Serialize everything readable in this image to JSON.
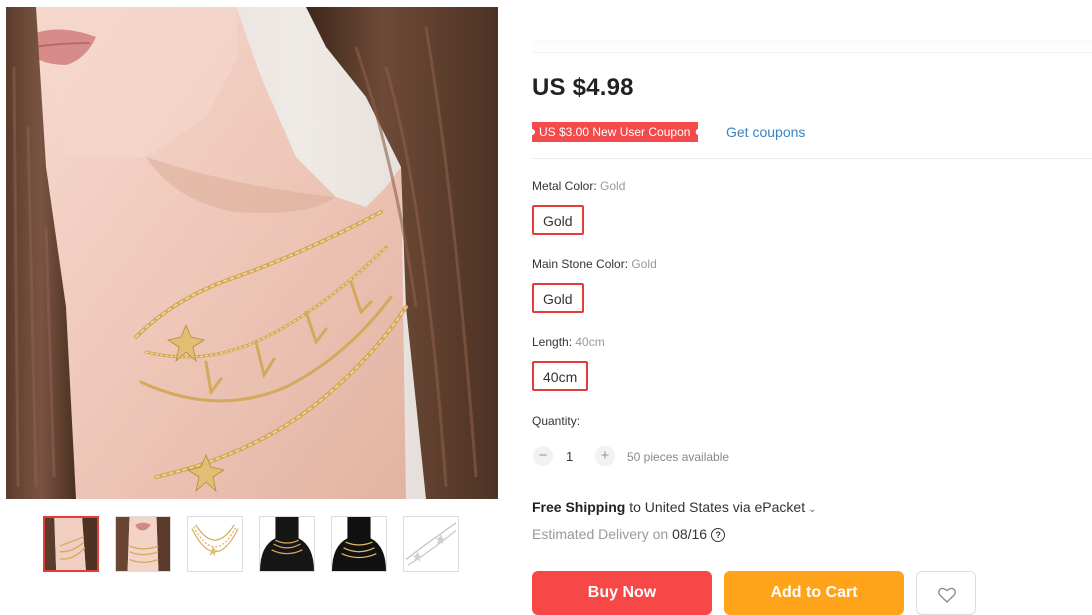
{
  "product": {
    "price": "US $4.98",
    "coupon": {
      "label": "US $3.00 New User Coupon",
      "link": "Get coupons"
    },
    "options": [
      {
        "name": "Metal Color: ",
        "value": "Gold",
        "selected": "Gold"
      },
      {
        "name": "Main Stone Color: ",
        "value": "Gold",
        "selected": "Gold"
      },
      {
        "name": "Length: ",
        "value": "40cm",
        "selected": "40cm"
      }
    ],
    "quantity": {
      "label": "Quantity:",
      "minus": "−",
      "plus": "+",
      "value": "1",
      "available": "50 pieces available"
    },
    "shipping": {
      "method_bold": "Free Shipping",
      "rest": " to United States via ePacket",
      "chevron": "⌄"
    },
    "delivery": {
      "prefix": "Estimated Delivery on ",
      "date": "08/16",
      "help_icon_glyph": "?"
    },
    "actions": {
      "buy_now": "Buy Now",
      "add_to_cart": "Add to Cart",
      "wishlist_icon": "heart-icon"
    }
  },
  "gallery": {
    "thumbnails": [
      {
        "kind": "model-photo",
        "active": true
      },
      {
        "kind": "model-photo",
        "active": false
      },
      {
        "kind": "necklace-on-white",
        "active": false
      },
      {
        "kind": "necklace-on-black-bust",
        "active": false
      },
      {
        "kind": "necklace-on-black-bust",
        "active": false
      },
      {
        "kind": "necklace-detail",
        "active": false
      }
    ]
  },
  "colors": {
    "accent_red": "#f74747",
    "selected_border": "#e23d3a",
    "coupon_red": "#f44a4c",
    "link_blue": "#3a84c4",
    "cart_orange": "#ffa31a",
    "gold": "#d4a95c"
  }
}
